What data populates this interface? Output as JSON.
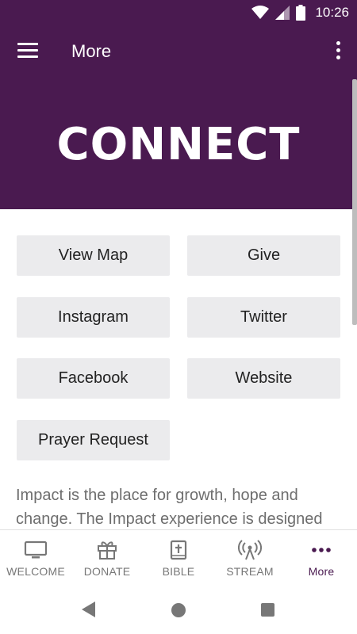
{
  "status": {
    "time": "10:26"
  },
  "appbar": {
    "title": "More"
  },
  "hero": {
    "title": "CONNECT"
  },
  "buttons": {
    "view_map": "View Map",
    "give": "Give",
    "instagram": "Instagram",
    "twitter": "Twitter",
    "facebook": "Facebook",
    "website": "Website",
    "prayer_request": "Prayer Request"
  },
  "description": "Impact is the place for growth, hope and change. The Impact experience is designed",
  "bottom_nav": {
    "welcome": "WELCOME",
    "donate": "DONATE",
    "bible": "BIBLE",
    "stream": "STREAM",
    "more": "More"
  },
  "colors": {
    "brand": "#4a1a50",
    "button_bg": "#ebebed"
  }
}
